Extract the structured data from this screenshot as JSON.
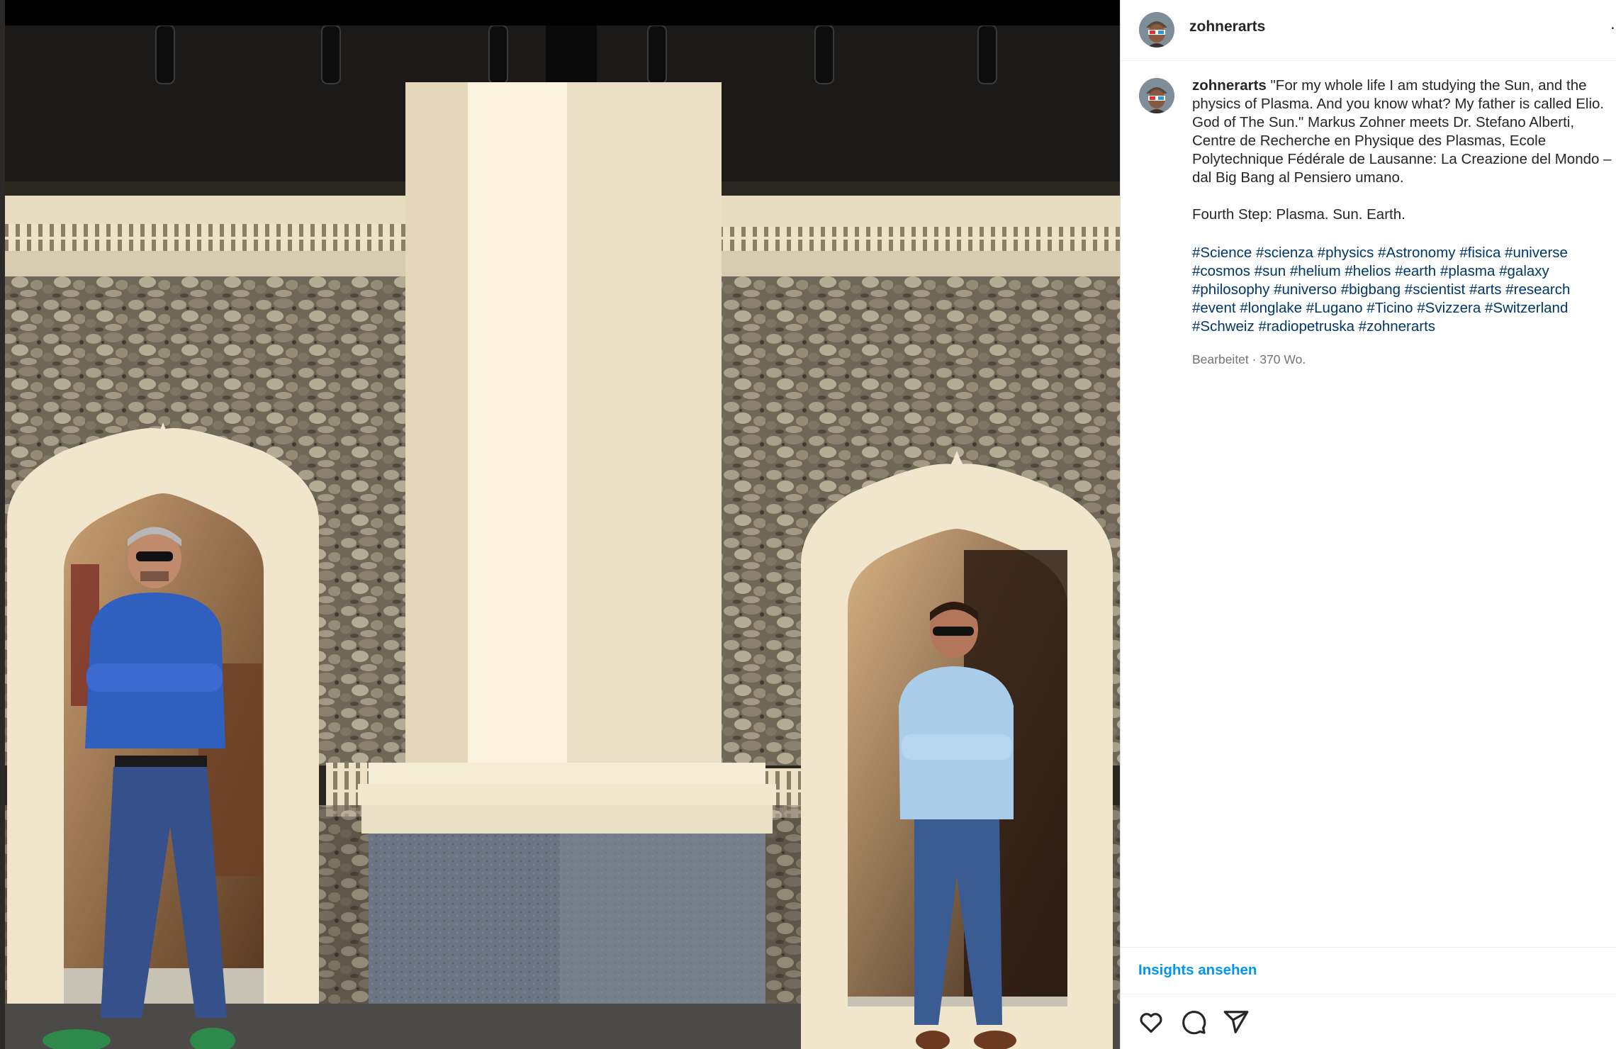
{
  "post": {
    "image_alt": "Two men in sunglasses standing with crossed arms in two ornate arched doorways of a stone-walled building"
  },
  "header": {
    "username": "zohnerarts",
    "more_icon": "ellipsis-icon"
  },
  "caption": {
    "username": "zohnerarts",
    "text": "\"For my whole life I am studying the Sun, and the physics of Plasma. And you know what? My father is called Elio. God of The Sun.\" Markus Zohner meets Dr. Stefano Alberti, Centre de Recherche en Physique des Plasmas, Ecole Polytechnique Fédérale de Lausanne: La Creazione del Mondo – dal Big Bang al Pensiero umano.\n\nFourth Step: Plasma. Sun. Earth.",
    "hashtags": [
      "#Science",
      "#scienza",
      "#physics",
      "#Astronomy",
      "#fisica",
      "#universe",
      "#cosmos",
      "#sun",
      "#helium",
      "#helios",
      "#earth",
      "#plasma",
      "#galaxy",
      "#philosophy",
      "#universo",
      "#bigbang",
      "#scientist",
      "#arts",
      "#research",
      "#event",
      "#longlake",
      "#Lugano",
      "#Ticino",
      "#Svizzera",
      "#Switzerland",
      "#Schweiz",
      "#radiopetruska",
      "#zohnerarts"
    ],
    "meta": "Bearbeitet · 370 Wo."
  },
  "insights": {
    "label": "Insights ansehen"
  },
  "actions": {
    "like_icon": "heart-icon",
    "comment_icon": "comment-icon",
    "share_icon": "paper-plane-icon"
  },
  "colors": {
    "link": "#0095f6",
    "hashtag": "#00376b",
    "meta": "#737373",
    "text": "#262626"
  }
}
